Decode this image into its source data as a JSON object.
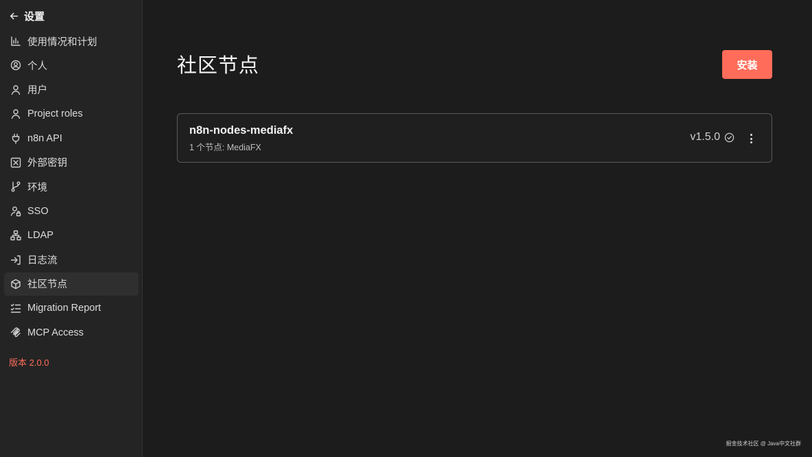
{
  "sidebar": {
    "back_label": "设置",
    "items": [
      {
        "label": "使用情况和计划",
        "icon": "chart-bar-icon"
      },
      {
        "label": "个人",
        "icon": "user-circle-icon"
      },
      {
        "label": "用户",
        "icon": "user-icon"
      },
      {
        "label": "Project roles",
        "icon": "user-icon"
      },
      {
        "label": "n8n API",
        "icon": "plug-icon"
      },
      {
        "label": "外部密钥",
        "icon": "vault-icon"
      },
      {
        "label": "环境",
        "icon": "git-branch-icon"
      },
      {
        "label": "SSO",
        "icon": "user-lock-icon"
      },
      {
        "label": "LDAP",
        "icon": "network-icon"
      },
      {
        "label": "日志流",
        "icon": "sign-in-icon"
      },
      {
        "label": "社区节点",
        "icon": "cube-icon",
        "active": true
      },
      {
        "label": "Migration Report",
        "icon": "list-checks-icon"
      },
      {
        "label": "MCP Access",
        "icon": "mcp-icon"
      }
    ],
    "version": "版本 2.0.0"
  },
  "main": {
    "title": "社区节点",
    "install_label": "安装",
    "packages": [
      {
        "name": "n8n-nodes-mediafx",
        "subtitle": "1 个节点: MediaFX",
        "version": "v1.5.0"
      }
    ]
  },
  "watermark": "掘金技术社区 @ Java中文社群",
  "colors": {
    "accent": "#ff6d5a",
    "background": "#1c1c1c",
    "sidebar": "#242424"
  }
}
